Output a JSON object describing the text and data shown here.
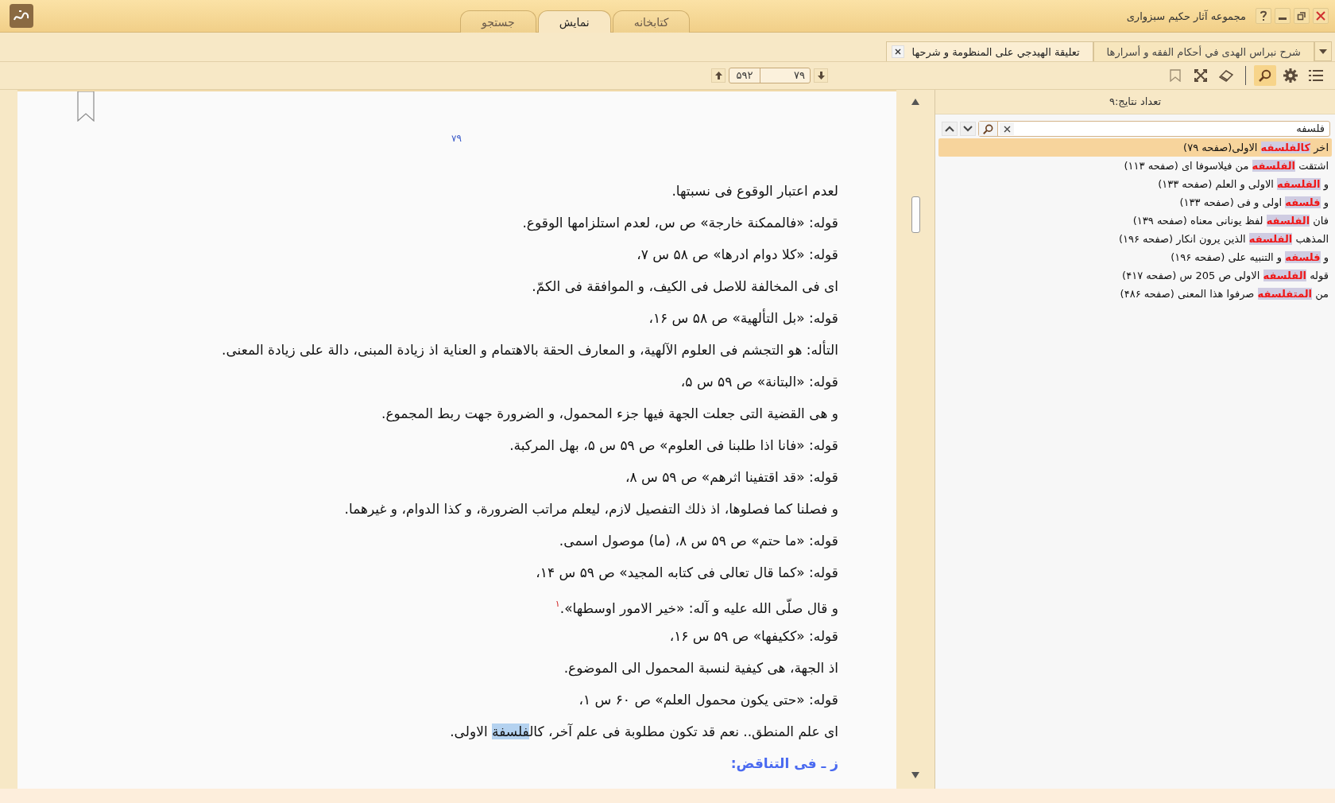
{
  "window": {
    "title": "مجموعه آثار حکیم سبزواری"
  },
  "tabs": [
    {
      "label": "کتابخانه",
      "selected": false
    },
    {
      "label": "نمایش",
      "selected": true
    },
    {
      "label": "جستجو",
      "selected": false
    }
  ],
  "doc_tabs": [
    {
      "label": "شرح نبراس الهدى في أحكام الفقه و أسرارها",
      "selected": false,
      "closable": false
    },
    {
      "label": "تعليقة الهيدجي على المنظومة و شرحها",
      "selected": true,
      "closable": true
    }
  ],
  "toolbar": {
    "tools": [
      {
        "kind": "list",
        "active": false
      },
      {
        "kind": "settings",
        "active": false
      },
      {
        "kind": "search",
        "active": true
      },
      {
        "kind": "eraser",
        "active": false
      },
      {
        "kind": "fullscreen",
        "active": false
      },
      {
        "kind": "bookmark",
        "active": false
      }
    ]
  },
  "pager": {
    "total": "۵۹۲",
    "current": "۷۹"
  },
  "page": {
    "number": "۷۹",
    "lines": [
      {
        "kind": "paragraph",
        "segments": [
          {
            "kind": "text",
            "text": "لعدم اعتبار الوقوع فی نسبتها."
          }
        ]
      },
      {
        "kind": "paragraph",
        "segments": [
          {
            "kind": "text",
            "text": "قوله: «فالممكنة خارجة» ص س، لعدم استلزامها الوقوع."
          }
        ]
      },
      {
        "kind": "paragraph",
        "segments": [
          {
            "kind": "text",
            "text": "قوله: «كلا دوام ادرها» ص ۵۸ س ۷،"
          }
        ]
      },
      {
        "kind": "paragraph",
        "segments": [
          {
            "kind": "text",
            "text": "ای فی المخالفة للاصل فی الكیف، و الموافقة فی الكمّ."
          }
        ]
      },
      {
        "kind": "paragraph",
        "segments": [
          {
            "kind": "text",
            "text": "قوله: «بل التألهیة» ص ۵۸ س ۱۶،"
          }
        ]
      },
      {
        "kind": "paragraph",
        "segments": [
          {
            "kind": "text",
            "text": "التأله: هو التجشم فی العلوم الآلهیة، و المعارف الحقة بالاهتمام و العنایة اذ زیادة المبنی، دالة علی زیادة المعنی."
          }
        ]
      },
      {
        "kind": "paragraph",
        "segments": [
          {
            "kind": "text",
            "text": "قوله: «البتانة» ص ۵۹ س ۵،"
          }
        ]
      },
      {
        "kind": "paragraph",
        "segments": [
          {
            "kind": "text",
            "text": "و هی القضیة التی جعلت الجهة فیها جزء المحمول، و الضرورة جهت ربط المجموع."
          }
        ]
      },
      {
        "kind": "paragraph",
        "segments": [
          {
            "kind": "text",
            "text": "قوله: «فانا اذا طلبنا فی العلوم» ص ۵۹ س ۵، بهل المركبة."
          }
        ]
      },
      {
        "kind": "paragraph",
        "segments": [
          {
            "kind": "text",
            "text": "قوله: «قد اقتفینا اثرهم» ص ۵۹ س ۸،"
          }
        ]
      },
      {
        "kind": "paragraph",
        "segments": [
          {
            "kind": "text",
            "text": "و فصلنا كما فصلوها، اذ ذلك التفصیل لازم، لیعلم مراتب الضرورة، و كذا الدوام، و غیرهما."
          }
        ]
      },
      {
        "kind": "paragraph",
        "segments": [
          {
            "kind": "text",
            "text": "قوله: «ما حتم» ص ۵۹ س ۸، (ما) موصول اسمی."
          }
        ]
      },
      {
        "kind": "paragraph",
        "segments": [
          {
            "kind": "text",
            "text": "قوله: «كما قال تعالی فی كتابه المجید» ص ۵۹ س ۱۴،"
          }
        ]
      },
      {
        "kind": "paragraph",
        "segments": [
          {
            "kind": "text",
            "text": "و قال صلّی الله علیه و آله: «خیر الامور اوسطها»."
          },
          {
            "kind": "footnote",
            "text": "١"
          }
        ]
      },
      {
        "kind": "paragraph",
        "segments": [
          {
            "kind": "text",
            "text": "قوله: «ككیفها» ص ۵۹ س ۱۶،"
          }
        ]
      },
      {
        "kind": "paragraph",
        "segments": [
          {
            "kind": "text",
            "text": "اذ الجهة، هی كیفیة لنسبة المحمول الی الموضوع."
          }
        ]
      },
      {
        "kind": "paragraph",
        "segments": [
          {
            "kind": "text",
            "text": "قوله: «حتی یكون محمول العلم» ص ۶۰ س ۱،"
          }
        ]
      },
      {
        "kind": "paragraph",
        "segments": [
          {
            "kind": "text",
            "text": "ای علم المنطق.. نعم قد تكون مطلوبة فی علم آخر، كال"
          },
          {
            "kind": "highlight",
            "text": "فلسفة"
          },
          {
            "kind": "text",
            "text": " الاولی."
          }
        ]
      },
      {
        "kind": "heading",
        "segments": [
          {
            "kind": "text",
            "text": "ز ـ فی التناقض:"
          }
        ]
      }
    ]
  },
  "search_panel": {
    "result_count": "تعداد نتایج:۹",
    "query": "فلسفه",
    "results": [
      {
        "before": "اخر ",
        "match": "كالفلسفه",
        "after": " الاولی(صفحه ۷۹)",
        "selected": true
      },
      {
        "before": "اشتقت ",
        "match": "الفلسفه",
        "after": " من فيلاسوفا ای (صفحه ۱۱۳)",
        "selected": false
      },
      {
        "before": "و ",
        "match": "الفلسفه",
        "after": " الاولی و العلم (صفحه ۱۳۳)",
        "selected": false
      },
      {
        "before": "و ",
        "match": "فلسفه",
        "after": " اولی و فی (صفحه ۱۳۳)",
        "selected": false
      },
      {
        "before": "فان ",
        "match": "الفلسفه",
        "after": " لفظ یونانی معناه (صفحه ۱۳۹)",
        "selected": false
      },
      {
        "before": "المذهب ",
        "match": "الفلسفه",
        "after": " الذين يرون انكار (صفحه ۱۹۶)",
        "selected": false
      },
      {
        "before": "و ",
        "match": "فلسفه",
        "after": " و التنبيه على (صفحه ۱۹۶)",
        "selected": false
      },
      {
        "before": "قوله ",
        "match": "الفلسفه",
        "after": " الاولی ص 205 س (صفحه ۴۱۷)",
        "selected": false
      },
      {
        "before": "من ",
        "match": "المتفلسفه",
        "after": " صرفوا هذا المعنى (صفحه ۴۸۶)",
        "selected": false
      }
    ]
  }
}
